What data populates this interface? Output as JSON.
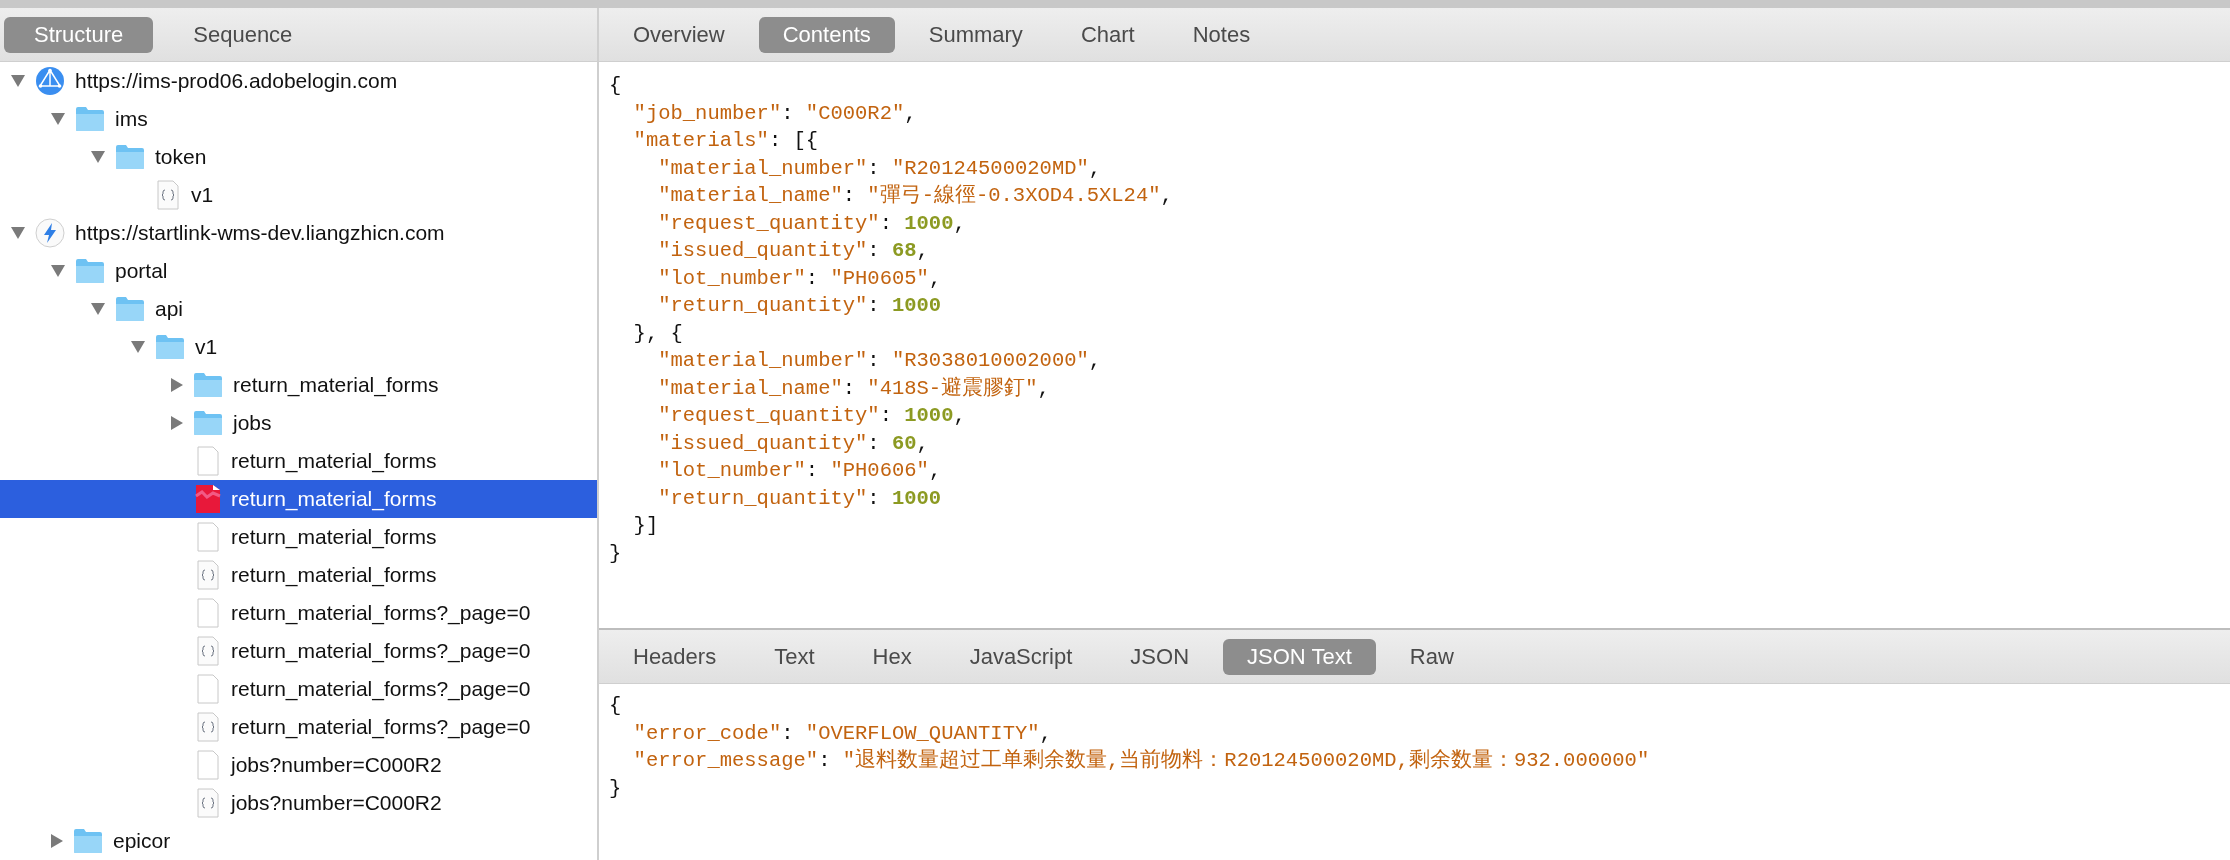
{
  "structure_tabs": [
    {
      "label": "Structure",
      "selected": true
    },
    {
      "label": "Sequence",
      "selected": false
    }
  ],
  "tree": [
    {
      "label": "https://ims-prod06.adobelogin.com",
      "kind": "host-globe",
      "expanded": true,
      "selected": false,
      "children": [
        {
          "label": "ims",
          "kind": "folder",
          "expanded": true,
          "selected": false,
          "children": [
            {
              "label": "token",
              "kind": "folder",
              "expanded": true,
              "selected": false,
              "children": [
                {
                  "label": "v1",
                  "kind": "file-json",
                  "selected": false
                }
              ]
            }
          ]
        }
      ]
    },
    {
      "label": "https://startlink-wms-dev.liangzhicn.com",
      "kind": "host-bolt",
      "expanded": true,
      "selected": false,
      "children": [
        {
          "label": "portal",
          "kind": "folder",
          "expanded": true,
          "selected": false,
          "children": [
            {
              "label": "api",
              "kind": "folder",
              "expanded": true,
              "selected": false,
              "children": [
                {
                  "label": "v1",
                  "kind": "folder",
                  "expanded": true,
                  "selected": false,
                  "children": [
                    {
                      "label": "return_material_forms",
                      "kind": "folder",
                      "expanded": false,
                      "selected": false
                    },
                    {
                      "label": "jobs",
                      "kind": "folder",
                      "expanded": false,
                      "selected": false
                    },
                    {
                      "label": "return_material_forms",
                      "kind": "file-blank",
                      "selected": false
                    },
                    {
                      "label": "return_material_forms",
                      "kind": "file-broken",
                      "selected": true
                    },
                    {
                      "label": "return_material_forms",
                      "kind": "file-blank",
                      "selected": false
                    },
                    {
                      "label": "return_material_forms",
                      "kind": "file-json",
                      "selected": false
                    },
                    {
                      "label": "return_material_forms?_page=0",
                      "kind": "file-blank",
                      "selected": false
                    },
                    {
                      "label": "return_material_forms?_page=0",
                      "kind": "file-json",
                      "selected": false
                    },
                    {
                      "label": "return_material_forms?_page=0",
                      "kind": "file-blank",
                      "selected": false
                    },
                    {
                      "label": "return_material_forms?_page=0",
                      "kind": "file-json",
                      "selected": false
                    },
                    {
                      "label": "jobs?number=C000R2",
                      "kind": "file-blank",
                      "selected": false
                    },
                    {
                      "label": "jobs?number=C000R2",
                      "kind": "file-json",
                      "selected": false
                    }
                  ]
                }
              ]
            }
          ]
        },
        {
          "label": "epicor",
          "kind": "folder",
          "expanded": false,
          "selected": false
        }
      ]
    }
  ],
  "viewer_tabs": [
    {
      "label": "Overview",
      "selected": false
    },
    {
      "label": "Contents",
      "selected": true
    },
    {
      "label": "Summary",
      "selected": false
    },
    {
      "label": "Chart",
      "selected": false
    },
    {
      "label": "Notes",
      "selected": false
    }
  ],
  "request_body": [
    [
      {
        "kind": "punct",
        "text": "{"
      }
    ],
    [
      {
        "kind": "key",
        "text": "  \"job_number\""
      },
      {
        "kind": "punct",
        "text": ": "
      },
      {
        "kind": "string",
        "text": "\"C000R2\""
      },
      {
        "kind": "punct",
        "text": ","
      }
    ],
    [
      {
        "kind": "key",
        "text": "  \"materials\""
      },
      {
        "kind": "punct",
        "text": ": [{"
      }
    ],
    [
      {
        "kind": "key",
        "text": "    \"material_number\""
      },
      {
        "kind": "punct",
        "text": ": "
      },
      {
        "kind": "string",
        "text": "\"R20124500020MD\""
      },
      {
        "kind": "punct",
        "text": ","
      }
    ],
    [
      {
        "kind": "key",
        "text": "    \"material_name\""
      },
      {
        "kind": "punct",
        "text": ": "
      },
      {
        "kind": "string",
        "text": "\"彈弓-線徑-0.3XOD4.5XL24\""
      },
      {
        "kind": "punct",
        "text": ","
      }
    ],
    [
      {
        "kind": "key",
        "text": "    \"request_quantity\""
      },
      {
        "kind": "punct",
        "text": ": "
      },
      {
        "kind": "number",
        "text": "1000"
      },
      {
        "kind": "punct",
        "text": ","
      }
    ],
    [
      {
        "kind": "key",
        "text": "    \"issued_quantity\""
      },
      {
        "kind": "punct",
        "text": ": "
      },
      {
        "kind": "number",
        "text": "68"
      },
      {
        "kind": "punct",
        "text": ","
      }
    ],
    [
      {
        "kind": "key",
        "text": "    \"lot_number\""
      },
      {
        "kind": "punct",
        "text": ": "
      },
      {
        "kind": "string",
        "text": "\"PH0605\""
      },
      {
        "kind": "punct",
        "text": ","
      }
    ],
    [
      {
        "kind": "key",
        "text": "    \"return_quantity\""
      },
      {
        "kind": "punct",
        "text": ": "
      },
      {
        "kind": "number",
        "text": "1000"
      }
    ],
    [
      {
        "kind": "punct",
        "text": "  }, {"
      }
    ],
    [
      {
        "kind": "key",
        "text": "    \"material_number\""
      },
      {
        "kind": "punct",
        "text": ": "
      },
      {
        "kind": "string",
        "text": "\"R3038010002000\""
      },
      {
        "kind": "punct",
        "text": ","
      }
    ],
    [
      {
        "kind": "key",
        "text": "    \"material_name\""
      },
      {
        "kind": "punct",
        "text": ": "
      },
      {
        "kind": "string",
        "text": "\"418S-避震膠釘\""
      },
      {
        "kind": "punct",
        "text": ","
      }
    ],
    [
      {
        "kind": "key",
        "text": "    \"request_quantity\""
      },
      {
        "kind": "punct",
        "text": ": "
      },
      {
        "kind": "number",
        "text": "1000"
      },
      {
        "kind": "punct",
        "text": ","
      }
    ],
    [
      {
        "kind": "key",
        "text": "    \"issued_quantity\""
      },
      {
        "kind": "punct",
        "text": ": "
      },
      {
        "kind": "number",
        "text": "60"
      },
      {
        "kind": "punct",
        "text": ","
      }
    ],
    [
      {
        "kind": "key",
        "text": "    \"lot_number\""
      },
      {
        "kind": "punct",
        "text": ": "
      },
      {
        "kind": "string",
        "text": "\"PH0606\""
      },
      {
        "kind": "punct",
        "text": ","
      }
    ],
    [
      {
        "kind": "key",
        "text": "    \"return_quantity\""
      },
      {
        "kind": "punct",
        "text": ": "
      },
      {
        "kind": "number",
        "text": "1000"
      }
    ],
    [
      {
        "kind": "punct",
        "text": "  }]"
      }
    ],
    [
      {
        "kind": "punct",
        "text": "}"
      }
    ]
  ],
  "response_tabs": [
    {
      "label": "Headers",
      "selected": false
    },
    {
      "label": "Text",
      "selected": false
    },
    {
      "label": "Hex",
      "selected": false
    },
    {
      "label": "JavaScript",
      "selected": false
    },
    {
      "label": "JSON",
      "selected": false
    },
    {
      "label": "JSON Text",
      "selected": true
    },
    {
      "label": "Raw",
      "selected": false
    }
  ],
  "response_body": [
    [
      {
        "kind": "punct",
        "text": "{"
      }
    ],
    [
      {
        "kind": "key",
        "text": "  \"error_code\""
      },
      {
        "kind": "punct",
        "text": ": "
      },
      {
        "kind": "string",
        "text": "\"OVERFLOW_QUANTITY\""
      },
      {
        "kind": "punct",
        "text": ","
      }
    ],
    [
      {
        "kind": "key",
        "text": "  \"error_message\""
      },
      {
        "kind": "punct",
        "text": ": "
      },
      {
        "kind": "string",
        "text": "\"退料数量超过工单剩余数量,当前物料：R20124500020MD,剩余数量：932.000000\""
      }
    ],
    [
      {
        "kind": "punct",
        "text": "}"
      }
    ]
  ]
}
